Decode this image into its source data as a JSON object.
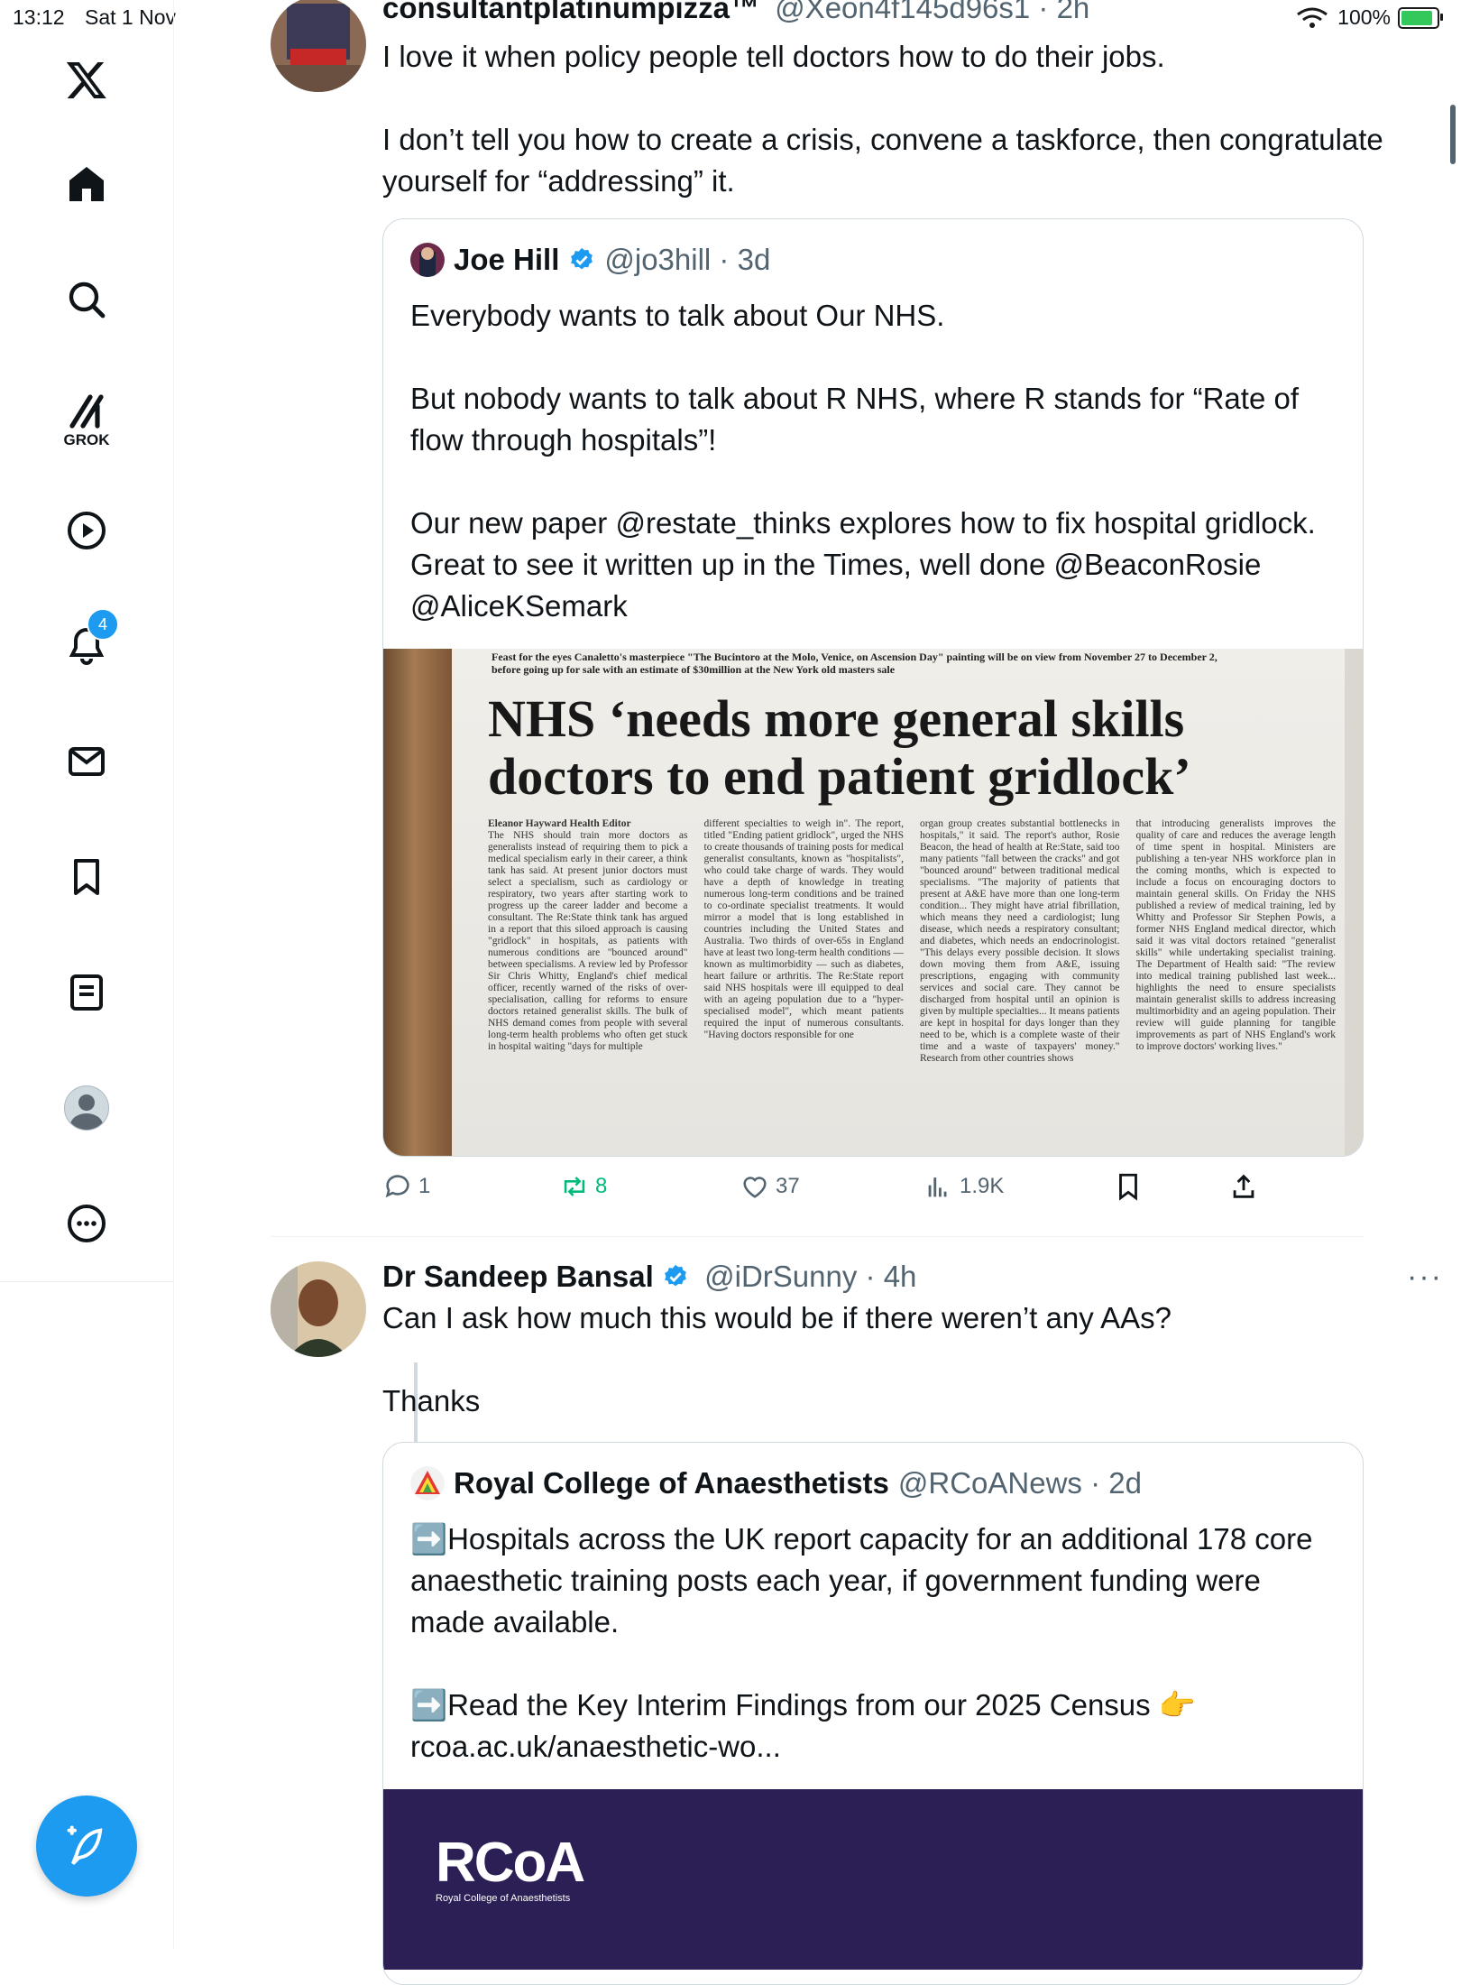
{
  "status_bar": {
    "time": "13:12",
    "date": "Sat 1 Nov",
    "battery": "100%"
  },
  "sidebar": {
    "items": [
      "Home",
      "Search",
      "Grok",
      "Video",
      "Notifications",
      "Messages",
      "Bookmarks",
      "Lists",
      "Profile",
      "More"
    ],
    "grok_label": "GROK",
    "notification_count": "4"
  },
  "tweets": [
    {
      "name": "consultantplatinumpizza™",
      "handle": "@Xeon4f145d96s1",
      "time": "2h",
      "text": [
        "I love it when policy people tell doctors how to do their jobs.",
        "I don’t tell you how to create a crisis, convene a taskforce, then congratulate yourself for “addressing” it."
      ],
      "quote": {
        "name": "Joe Hill",
        "handle": "@jo3hill",
        "time": "3d",
        "text": [
          "Everybody wants to talk about Our NHS.",
          "But nobody wants to talk about R NHS, where R stands for “Rate of flow through hospitals”!",
          "Our new paper @restate_thinks explores how to fix hospital gridlock. Great to see it written up in the Times, well done @BeaconRosie @AliceKSemark"
        ],
        "image": {
          "kicker": "Feast for the eyes Canaletto's masterpiece \"The Bucintoro at the Molo, Venice, on Ascension Day\" painting will be on view from November 27 to December 2, before going up for sale with an estimate of $30million at the New York old masters sale",
          "headline": "NHS ‘needs more general skills doctors to end patient gridlock’",
          "byline": "Eleanor Hayward Health Editor",
          "columns": [
            "The NHS should train more doctors as generalists instead of requiring them to pick a medical specialism early in their career, a think tank has said. At present junior doctors must select a specialism, such as cardiology or respiratory, two years after starting work to progress up the career ladder and become a consultant. The Re:State think tank has argued in a report that this siloed approach is causing \"gridlock\" in hospitals, as patients with numerous conditions are \"bounced around\" between specialisms. A review led by Professor Sir Chris Whitty, England's chief medical officer, recently warned of the risks of over-specialisation, calling for reforms to ensure doctors retained generalist skills. The bulk of NHS demand comes from people with several long-term health problems who often get stuck in hospital waiting \"days for multiple",
            "different specialties to weigh in\". The report, titled \"Ending patient gridlock\", urged the NHS to create thousands of training posts for medical generalist consultants, known as \"hospitalists\", who could take charge of wards. They would have a depth of knowledge in treating numerous long-term conditions and be trained to co-ordinate specialist treatments. It would mirror a model that is long established in countries including the United States and Australia. Two thirds of over-65s in England have at least two long-term health conditions — known as multimorbidity — such as diabetes, heart failure or arthritis. The Re:State report said NHS hospitals were ill equipped to deal with an ageing population due to a \"hyper-specialised model\", which meant patients required the input of numerous consultants. \"Having doctors responsible for one",
            "organ group creates substantial bottlenecks in hospitals,\" it said. The report's author, Rosie Beacon, the head of health at Re:State, said too many patients \"fall between the cracks\" and got \"bounced around\" between traditional medical specialisms. \"The majority of patients that present at A&E have more than one long-term condition... They might have atrial fibrillation, which means they need a cardiologist; lung disease, which needs a respiratory consultant; and diabetes, which needs an endocrinologist. \"This delays every possible decision. It slows down moving them from A&E, issuing prescriptions, engaging with community services and social care. They cannot be discharged from hospital until an opinion is given by multiple specialties... It means patients are kept in hospital for days longer than they need to be, which is a complete waste of their time and a waste of taxpayers' money.\" Research from other countries shows",
            "that introducing generalists improves the quality of care and reduces the average length of time spent in hospital. Ministers are publishing a ten-year NHS workforce plan in the coming months, which is expected to include a focus on encouraging doctors to maintain general skills. On Friday the NHS published a review of medical training, led by Whitty and Professor Sir Stephen Powis, a former NHS England medical director, which said it was vital doctors retained \"generalist skills\" while undertaking specialist training. The Department of Health said: \"The review into medical training published last week... highlights the need to ensure specialists maintain generalist skills to address increasing multimorbidity and an ageing population. Their review will guide planning for tangible improvements as part of NHS England's work to improve doctors' working lives.\""
          ]
        }
      },
      "stats": {
        "replies": "1",
        "reposts": "8",
        "likes": "37",
        "views": "1.9K"
      }
    },
    {
      "name": "Dr Sandeep Bansal",
      "handle": "@iDrSunny",
      "time": "4h",
      "more": "···",
      "text": [
        "Can I ask how much this would be if there weren’t any AAs?",
        "Thanks"
      ],
      "quote": {
        "name": "Royal College of Anaesthetists",
        "handle": "@RCoANews",
        "time": "2d",
        "text": [
          "➡️Hospitals across the UK report capacity for an additional 178 core anaesthetic training posts each year, if government funding were made available.",
          "➡️Read the Key Interim Findings from our 2025 Census 👉 rcoa.ac.uk/anaesthetic-wo..."
        ],
        "image": {
          "logo": "RCoA",
          "logo_sub": "Royal College of Anaesthetists"
        }
      }
    }
  ],
  "colors": {
    "accent": "#1d9bf0",
    "text": "#0f1419",
    "secondary": "#536471",
    "repost": "#00ba7c"
  }
}
